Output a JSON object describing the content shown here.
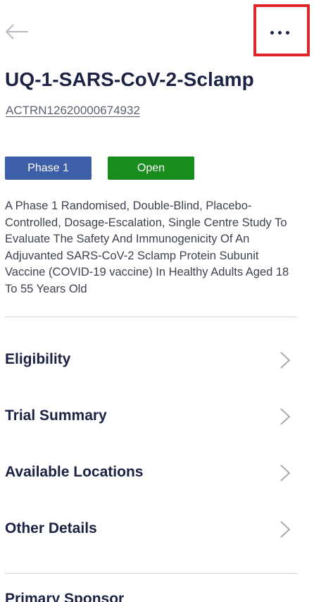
{
  "trial": {
    "title": "UQ-1-SARS-CoV-2-Sclamp",
    "registry_id": "ACTRN12620000674932",
    "phase": "Phase 1",
    "status": "Open",
    "description": "A Phase 1 Randomised, Double-Blind, Placebo-Controlled, Dosage-Escalation, Single Centre Study To Evaluate The  Safety And Immunogenicity  Of An Adjuvanted SARS-CoV-2 Sclamp Protein Subunit Vaccine (COVID-19 vaccine) In Healthy Adults Aged 18 To 55 Years Old"
  },
  "colors": {
    "phase_badge": "#3d5fa8",
    "status_badge": "#198c1e",
    "highlight_box": "#e0242a",
    "heading_text": "#1b2244"
  },
  "icons": {
    "back": "arrow-left-icon",
    "more": "more-horizontal-icon",
    "chevron": "chevron-right-icon"
  },
  "menu": {
    "items": [
      {
        "label": "Eligibility"
      },
      {
        "label": "Trial Summary"
      },
      {
        "label": "Available Locations"
      },
      {
        "label": "Other Details"
      }
    ]
  },
  "partial_section": {
    "label": "Primary Sponsor"
  }
}
